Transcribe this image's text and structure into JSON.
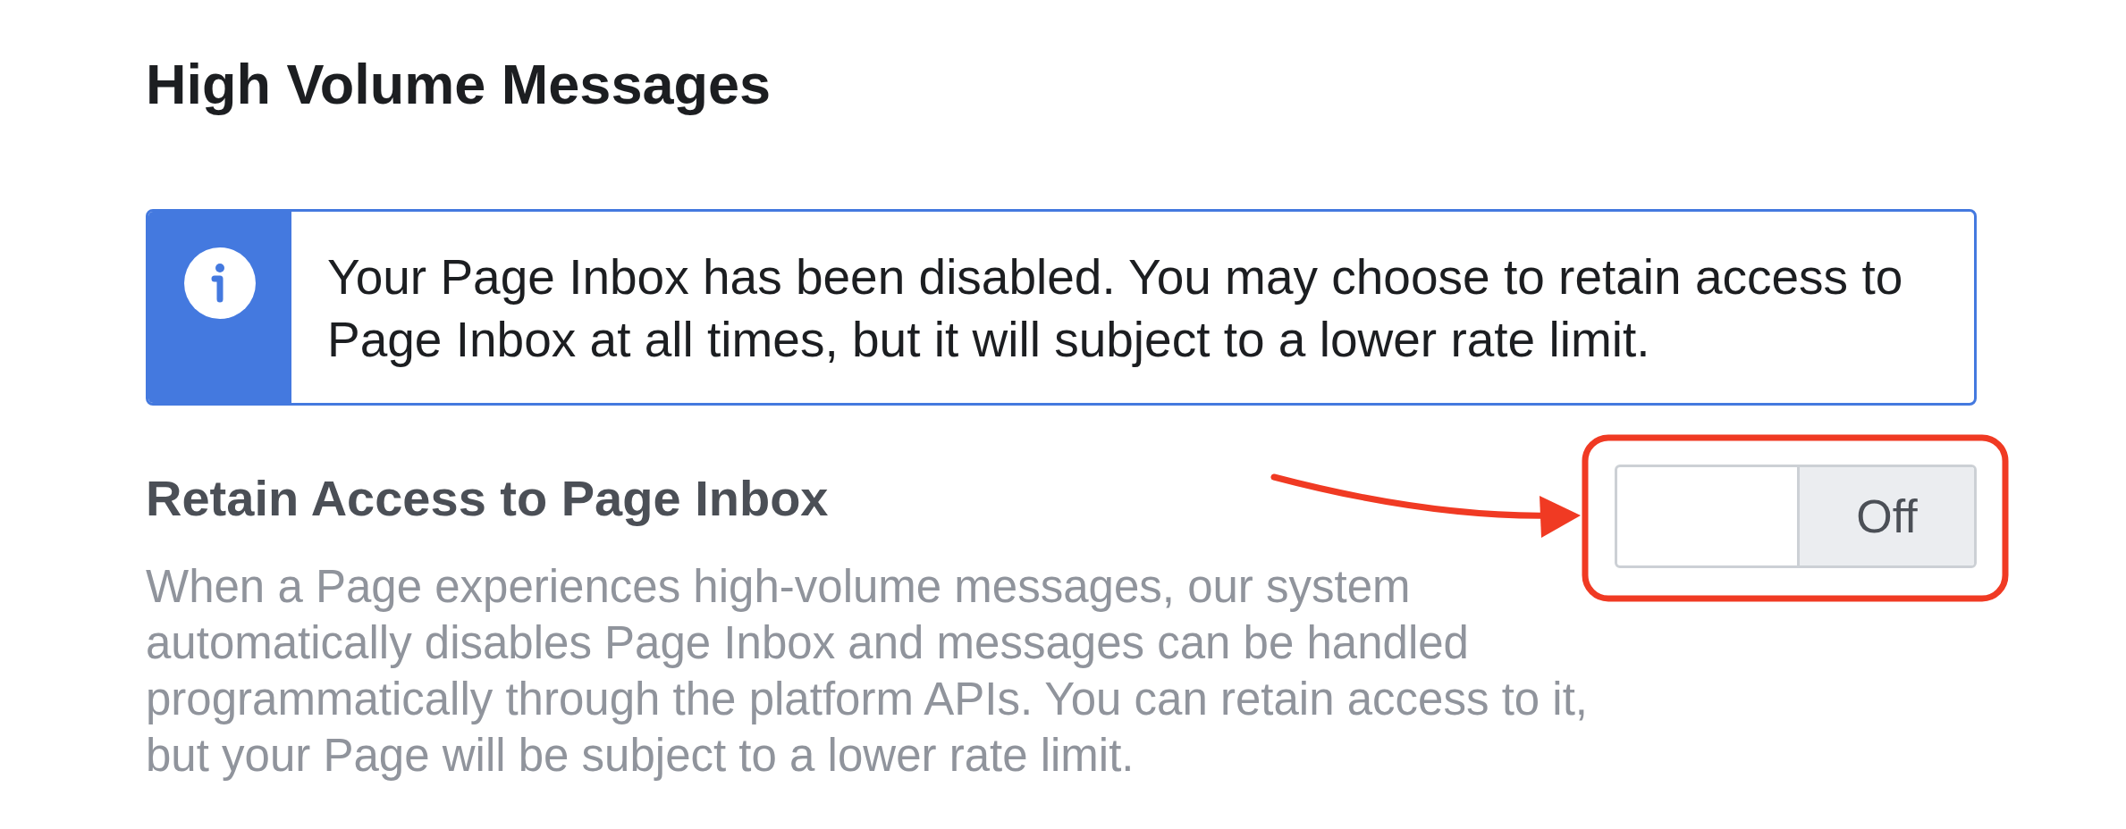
{
  "section_title": "High Volume Messages",
  "notice": {
    "text": "Your Page Inbox has been disabled. You may choose to retain access to Page Inbox at all times, but it will subject to a lower rate limit."
  },
  "setting": {
    "title": "Retain Access to Page Inbox",
    "description": "When a Page experiences high-volume messages, our system automatically disables Page Inbox and messages can be handled programmatically through the platform APIs. You can retain access to it, but your Page will be subject to a lower rate limit.",
    "toggle": {
      "label": "Off",
      "on": false
    }
  }
}
